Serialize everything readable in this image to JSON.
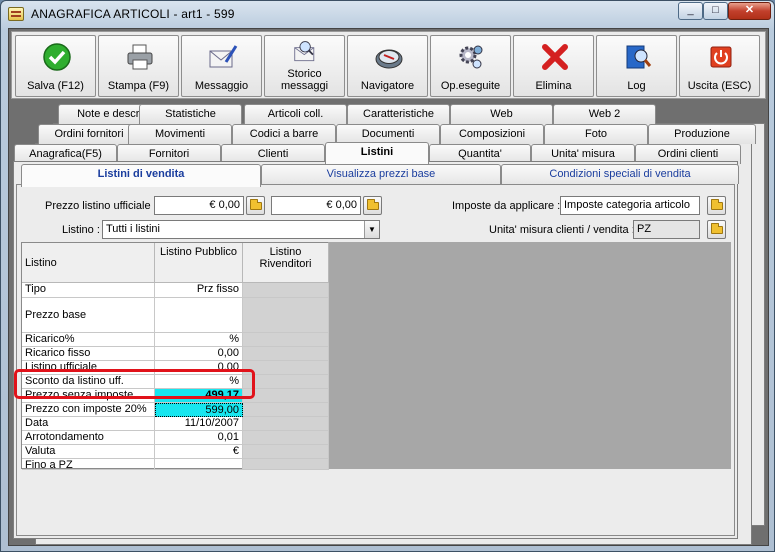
{
  "window": {
    "title": "ANAGRAFICA ARTICOLI - art1 - 599",
    "min_label": "_",
    "max_label": "□",
    "close_label": "✕"
  },
  "toolbar": [
    {
      "label": "Salva (F12)",
      "icon": "check-icon"
    },
    {
      "label": "Stampa (F9)",
      "icon": "printer-icon"
    },
    {
      "label": "Messaggio",
      "icon": "envelope-pen-icon"
    },
    {
      "label": "Storico\nmessaggi",
      "icon": "envelope-search-icon"
    },
    {
      "label": "Navigatore",
      "icon": "compass-icon"
    },
    {
      "label": "Op.eseguite",
      "icon": "gears-search-icon"
    },
    {
      "label": "Elimina",
      "icon": "red-x-icon"
    },
    {
      "label": "Log",
      "icon": "book-search-icon"
    },
    {
      "label": "Uscita (ESC)",
      "icon": "power-icon"
    }
  ],
  "tabs_row1": [
    "Note e descr.",
    "Statistiche",
    "Articoli coll.",
    "Caratteristiche",
    "Web",
    "Web 2"
  ],
  "tabs_row2": [
    "Ordini fornitori",
    "Movimenti",
    "Codici a barre",
    "Documenti",
    "Composizioni",
    "Foto",
    "Produzione"
  ],
  "tabs_row3": [
    "Anagrafica(F5)",
    "Fornitori",
    "Clienti",
    "Listini",
    "Quantita'",
    "Unita' misura",
    "Ordini clienti"
  ],
  "inner_tabs": [
    "Listini di vendita",
    "Visualizza prezzi base",
    "Condizioni speciali di vendita"
  ],
  "form": {
    "prezzo_label": "Prezzo listino ufficiale :",
    "prezzo_value1": "€ 0,00",
    "prezzo_value2": "€ 0,00",
    "imposte_label": "Imposte da applicare :",
    "imposte_value": "Imposte categoria articolo",
    "listino_label": "Listino :",
    "listino_value": "Tutti i listini",
    "unita_label": "Unita' misura clienti / vendita :",
    "unita_value": "PZ"
  },
  "grid": {
    "headers": [
      "Listino",
      "Listino Pubblico",
      "Listino Rivenditori"
    ],
    "rows": [
      {
        "label": "Tipo",
        "value": "Prz fisso"
      },
      {
        "label": "Prezzo base",
        "value": ""
      },
      {
        "label": "Ricarico%",
        "value": "%"
      },
      {
        "label": "Ricarico fisso",
        "value": "0,00"
      },
      {
        "label": "Listino ufficiale",
        "value": "0,00"
      },
      {
        "label": "Sconto da listino uff.",
        "value": "%"
      },
      {
        "label": "Prezzo senza imposte",
        "value": "499,17"
      },
      {
        "label": "Prezzo con imposte 20%",
        "value": "599,00"
      },
      {
        "label": "Data",
        "value": "11/10/2007"
      },
      {
        "label": "Arrotondamento",
        "value": "0,01"
      },
      {
        "label": "Valuta",
        "value": "€"
      },
      {
        "label": "Fino a PZ",
        "value": ""
      }
    ]
  },
  "colors": {
    "highlight_cell": "#17e6ef",
    "annotation_box": "#e1121a"
  }
}
